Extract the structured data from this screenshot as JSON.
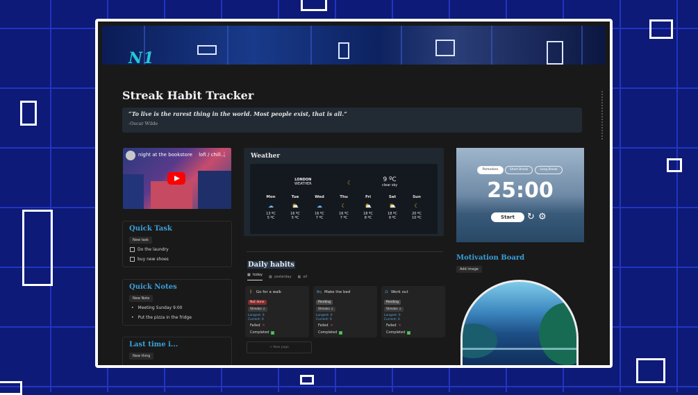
{
  "banner": {
    "logo_text": "N1"
  },
  "page": {
    "title": "Streak Habit Tracker"
  },
  "quote": {
    "text": "“To live is the rarest thing in the world. Most people exist, that is all.”",
    "author": "-Oscar Wilde"
  },
  "video": {
    "title": "night at the bookstore  lofi / chill..."
  },
  "quick_task": {
    "title": "Quick Task",
    "new_label": "New task",
    "items": [
      "Do the laundry",
      "buy new shoes"
    ]
  },
  "quick_notes": {
    "title": "Quick Notes",
    "new_label": "New Note",
    "items": [
      "Meeting Sunday 9:00",
      "Put the pizza in the fridge"
    ]
  },
  "last_time": {
    "title": "Last time i...",
    "new_label": "New thing"
  },
  "weather": {
    "title": "Weather",
    "city": "LONDON",
    "city_sub": "WEATHER",
    "now_temp": "9 ºC",
    "now_desc": "clear sky",
    "days": [
      {
        "name": "Mon",
        "icon": "cloud-icon",
        "hi": "13 ºC",
        "lo": "5 ºC"
      },
      {
        "name": "Tue",
        "icon": "partly-cloudy-icon",
        "hi": "16 ºC",
        "lo": "5 ºC"
      },
      {
        "name": "Wed",
        "icon": "cloud-icon",
        "hi": "16 ºC",
        "lo": "7 ºC"
      },
      {
        "name": "Thu",
        "icon": "moon-icon",
        "hi": "16 ºC",
        "lo": "7 ºC"
      },
      {
        "name": "Fri",
        "icon": "partly-cloudy-icon",
        "hi": "18 ºC",
        "lo": "8 ºC"
      },
      {
        "name": "Sat",
        "icon": "partly-cloudy-icon",
        "hi": "18 ºC",
        "lo": "9 ºC"
      },
      {
        "name": "Sun",
        "icon": "moon-icon",
        "hi": "20 ºC",
        "lo": "10 ºC"
      }
    ]
  },
  "habits": {
    "title": "Daily habits",
    "tabs": [
      "today",
      "yesterday",
      "all"
    ],
    "cards": [
      {
        "name": "Go for a walk",
        "status": "Not done",
        "status_color": "#8a2a2a",
        "streak": "Streaks ↓",
        "longest": "Longest: 0",
        "current": "Current: 0",
        "failed": "Failed",
        "completed": "Completed"
      },
      {
        "name": "Make the bed",
        "status": "Pending",
        "status_color": "#4a4a4a",
        "streak": "Streaks ↓",
        "longest": "Longest: 0",
        "current": "Current: 0",
        "failed": "Failed",
        "completed": "Completed"
      },
      {
        "name": "Work out",
        "status": "Pending",
        "status_color": "#4a4a4a",
        "streak": "Streaks ↓",
        "longest": "Longest: 0",
        "current": "Current: 0",
        "failed": "Failed",
        "completed": "Completed"
      }
    ],
    "new_page": "+ New page"
  },
  "pomodoro": {
    "modes": [
      "Pomodoro",
      "Short Break",
      "Long Break"
    ],
    "time": "25:00",
    "start_label": "Start"
  },
  "motivation": {
    "title": "Motivation Board",
    "add_label": "Add image"
  }
}
